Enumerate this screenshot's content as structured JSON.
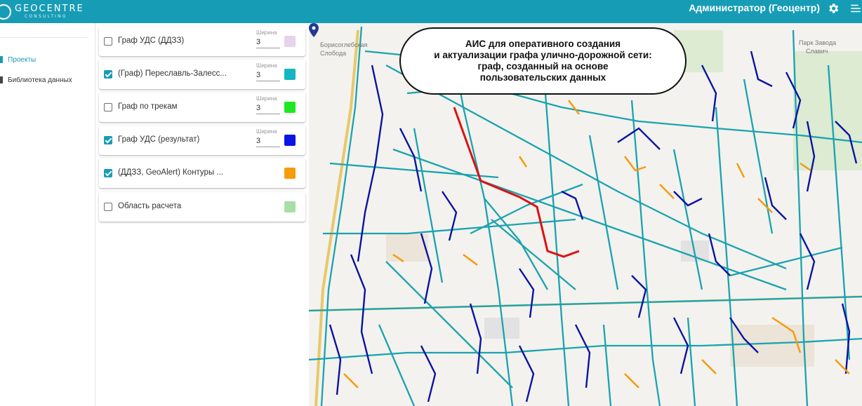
{
  "header": {
    "logo_main": "GEOCENTRE",
    "logo_sub": "CONSULTING",
    "user": "Администратор (Геоцентр)",
    "icons": [
      "gear-icon",
      "menu-icon"
    ],
    "color": "#179cb6"
  },
  "nav": {
    "items": [
      {
        "label": "Проекты",
        "active": true
      },
      {
        "label": "Библиотека данных",
        "active": false
      }
    ]
  },
  "layers": [
    {
      "name": "Граф УДС (ДДЗЗ)",
      "checked": false,
      "width_label": "Ширина",
      "width": "3",
      "color": "#e6d3ec"
    },
    {
      "name": "(Граф) Переславль-Залесс...",
      "checked": true,
      "width_label": "Ширина",
      "width": "3",
      "color": "#14b5c4"
    },
    {
      "name": "Граф по трекам",
      "checked": false,
      "width_label": "Ширина",
      "width": "3",
      "color": "#1ee820"
    },
    {
      "name": "Граф УДС (результат)",
      "checked": true,
      "width_label": "Ширина",
      "width": "3",
      "color": "#0a14e6"
    },
    {
      "name": "(ДДЗЗ, GeoAlert) Контуры ...",
      "checked": true,
      "color": "#f59b0c"
    },
    {
      "name": "Область расчета",
      "checked": false,
      "color": "#a8dfa6"
    }
  ],
  "map": {
    "callout": "АИС для оперативного создания\nи актуализации графа улично-дорожной сети:\nграф, созданный на основе\nпользовательских данных",
    "labels": {
      "sloboda1": "Борисоглебская",
      "sloboda2": "Слобода",
      "factory1": "Парк Завода",
      "factory2": "Славич"
    },
    "colors": {
      "teal": "#1aa3b0",
      "blue": "#0a14a0",
      "orange": "#f59b0c",
      "route": "#dd1111",
      "pin": "#1f3a8f"
    }
  }
}
